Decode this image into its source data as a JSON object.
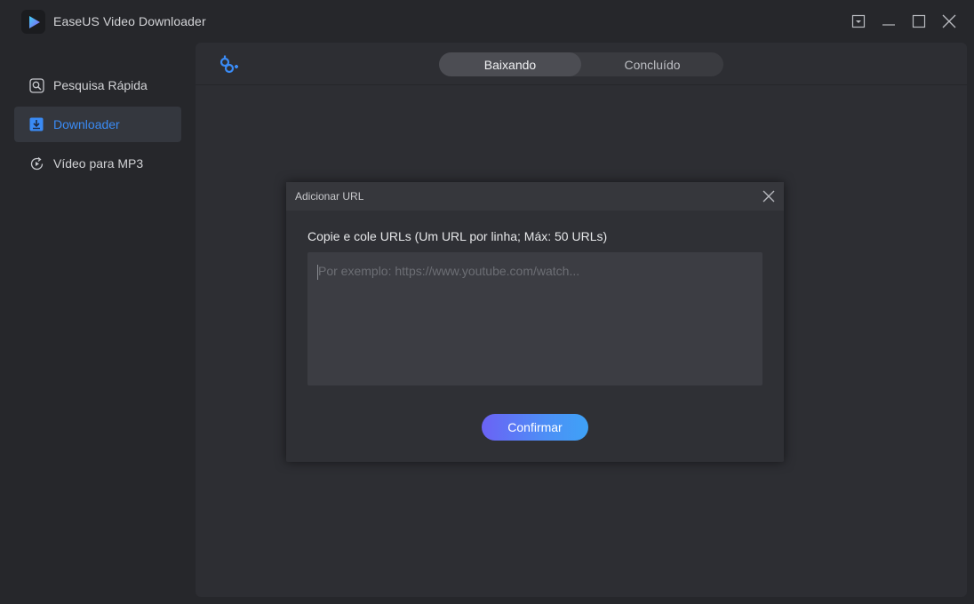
{
  "app": {
    "title": "EaseUS Video Downloader",
    "accent": "#3a8bf5"
  },
  "window_controls": [
    {
      "name": "menu-dropdown-icon"
    },
    {
      "name": "minimize-icon"
    },
    {
      "name": "maximize-icon"
    },
    {
      "name": "close-icon"
    }
  ],
  "sidebar": {
    "items": [
      {
        "label": "Pesquisa Rápida",
        "icon": "search-icon",
        "active": false
      },
      {
        "label": "Downloader",
        "icon": "download-icon",
        "active": true
      },
      {
        "label": "Vídeo para MP3",
        "icon": "convert-icon",
        "active": false
      }
    ]
  },
  "main": {
    "add_icon": "add-link-icon",
    "tabs": [
      {
        "label": "Baixando",
        "active": true
      },
      {
        "label": "Concluído",
        "active": false
      }
    ]
  },
  "dialog": {
    "title": "Adicionar URL",
    "instruction": "Copie e cole URLs (Um URL por linha; Máx: 50 URLs)",
    "input_value": "",
    "input_placeholder": "Por exemplo: https://www.youtube.com/watch...",
    "confirm_label": "Confirmar"
  }
}
